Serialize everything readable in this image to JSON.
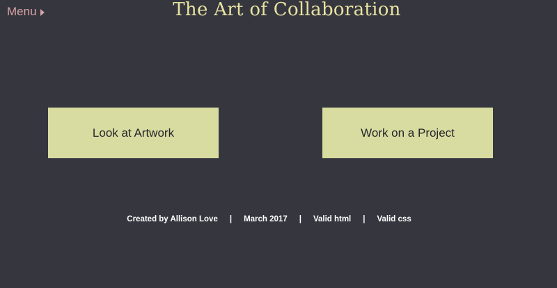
{
  "header": {
    "menu_label": "Menu",
    "menu_icon": "caret-right-icon",
    "title": "The Art of Collaboration"
  },
  "main": {
    "buttons": [
      {
        "label": "Look at Artwork"
      },
      {
        "label": "Work on a Project"
      }
    ]
  },
  "footer": {
    "credit": "Created by Allison Love",
    "separator": "|",
    "date": "March 2017",
    "valid_html": "Valid html",
    "valid_css": "Valid css"
  },
  "colors": {
    "background": "#36373e",
    "title": "#e8e2a2",
    "menu": "#d8a2a8",
    "button_bg": "#d8dca0",
    "button_text": "#26262b",
    "footer_text": "#ffffff"
  }
}
